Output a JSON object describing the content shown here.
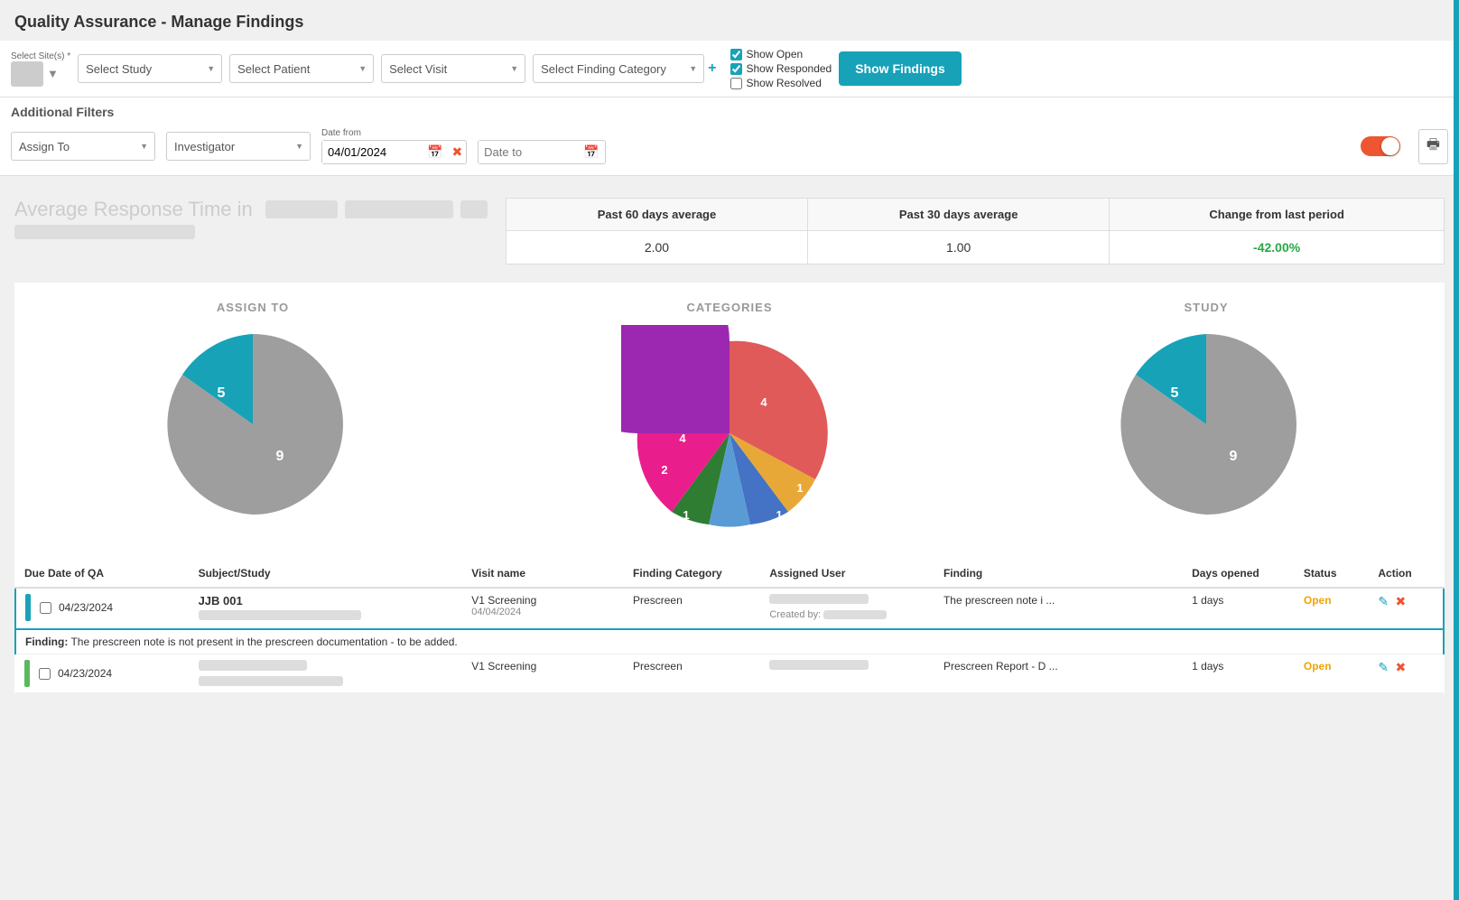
{
  "page": {
    "title": "Quality Assurance - Manage Findings"
  },
  "filters": {
    "site_label": "Select Site(s) *",
    "study_placeholder": "Select Study",
    "patient_placeholder": "Select Patient",
    "visit_placeholder": "Select Visit",
    "finding_category_placeholder": "Select Finding Category",
    "show_open_label": "Show Open",
    "show_responded_label": "Show Responded",
    "show_resolved_label": "Show Resolved",
    "show_findings_btn": "Show Findings"
  },
  "additional_filters": {
    "title": "Additional Filters",
    "assign_to_placeholder": "Assign To",
    "investigator_placeholder": "Investigator",
    "date_from_label": "Date from",
    "date_from_value": "04/01/2024",
    "date_to_placeholder": "Date to"
  },
  "avg_response": {
    "title_prefix": "Average Response Time in",
    "table": {
      "col1": "Past 60 days average",
      "col2": "Past 30 days average",
      "col3": "Change from last period",
      "val1": "2.00",
      "val2": "1.00",
      "val3": "-42.00%"
    }
  },
  "charts": {
    "assign_to_label": "ASSIGN TO",
    "categories_label": "CATEGORIES",
    "study_label": "STUDY",
    "assign_to_slices": [
      {
        "value": 5,
        "color": "#17a2b8",
        "angle_start": 0,
        "angle_end": 134
      },
      {
        "value": 9,
        "color": "#9e9e9e",
        "angle_start": 134,
        "angle_end": 360
      }
    ],
    "categories_slices": [
      {
        "value": 4,
        "color": "#e05a5a",
        "label": "4"
      },
      {
        "value": 1,
        "color": "#e8a838",
        "label": "1"
      },
      {
        "value": 1,
        "color": "#4472c4",
        "label": "1"
      },
      {
        "value": 1,
        "color": "#5b9bd5",
        "label": "1"
      },
      {
        "value": 1,
        "color": "#2e7d32",
        "label": "1"
      },
      {
        "value": 2,
        "color": "#e91e8c",
        "label": "2"
      },
      {
        "value": 4,
        "color": "#9c27b0",
        "label": "4"
      }
    ],
    "study_slices": [
      {
        "value": 5,
        "color": "#17a2b8"
      },
      {
        "value": 9,
        "color": "#9e9e9e"
      }
    ]
  },
  "table": {
    "columns": [
      "Due Date of QA",
      "Subject/Study",
      "Visit name",
      "Finding Category",
      "Assigned User",
      "Finding",
      "Days opened",
      "Status",
      "Action"
    ],
    "rows": [
      {
        "due_date": "04/23/2024",
        "subject": "JJB 001",
        "study_blurred": true,
        "visit_name": "V1 Screening",
        "visit_date": "04/04/2024",
        "finding_category": "Prescreen",
        "assigned_user_blurred": true,
        "created_by_blurred": true,
        "finding_short": "The prescreen note i ...",
        "days_opened": "1 days",
        "status": "Open",
        "expanded": true,
        "finding_full": "Finding: The prescreen note is not present in the prescreen documentation - to be added.",
        "indicator_color": "teal"
      },
      {
        "due_date": "04/23/2024",
        "subject_blurred": true,
        "study_blurred": true,
        "visit_name": "V1 Screening",
        "visit_date": "",
        "finding_category": "Prescreen",
        "assigned_user_blurred": true,
        "created_by_blurred": true,
        "finding_short": "Prescreen Report - D ...",
        "days_opened": "1 days",
        "status": "Open",
        "expanded": false,
        "indicator_color": "green"
      }
    ]
  }
}
